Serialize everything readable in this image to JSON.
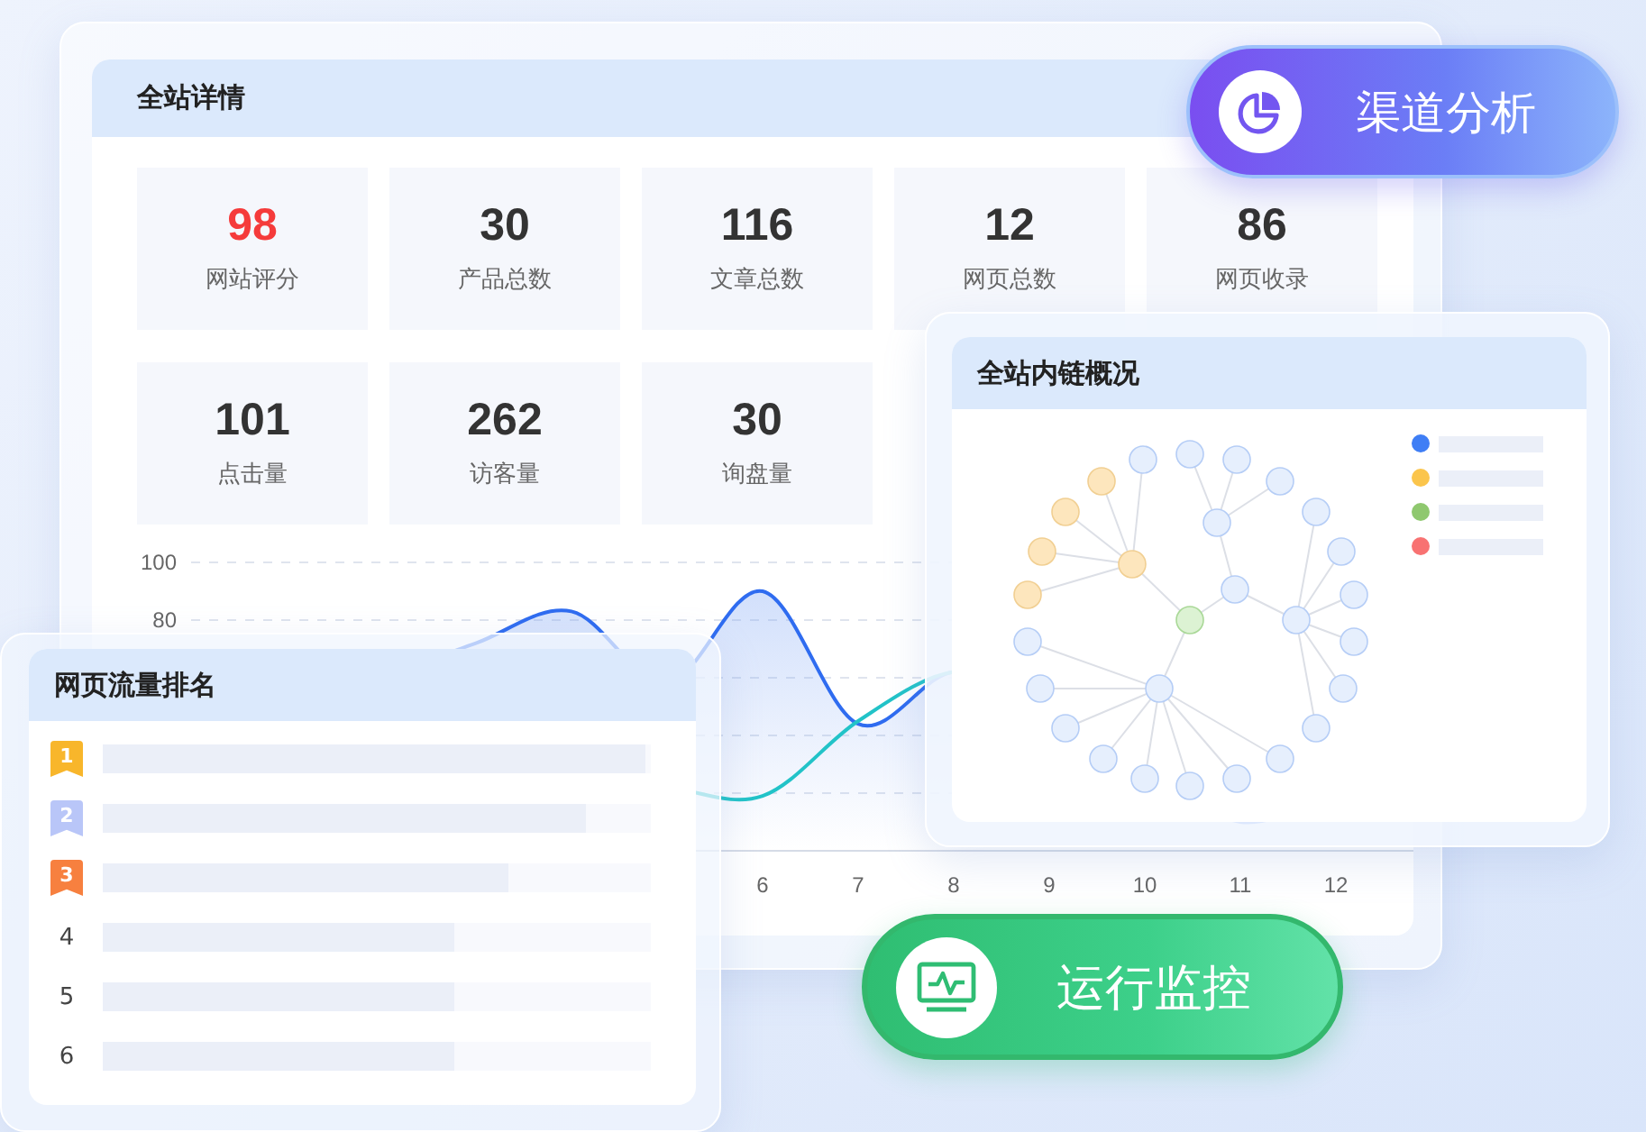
{
  "overview": {
    "title": "全站详情",
    "stats": [
      {
        "value": "98",
        "label": "网站评分",
        "color": "#f53b3b"
      },
      {
        "value": "30",
        "label": "产品总数",
        "color": "#333333"
      },
      {
        "value": "116",
        "label": "文章总数",
        "color": "#333333"
      },
      {
        "value": "12",
        "label": "网页总数",
        "color": "#333333"
      },
      {
        "value": "86",
        "label": "网页收录",
        "color": "#333333"
      },
      {
        "value": "101",
        "label": "点击量",
        "color": "#333333"
      },
      {
        "value": "262",
        "label": "访客量",
        "color": "#333333"
      },
      {
        "value": "30",
        "label": "询盘量",
        "color": "#333333"
      }
    ],
    "chart": {
      "y_labels": [
        "100",
        "80"
      ],
      "x_labels": [
        "6",
        "7",
        "8",
        "9",
        "10",
        "11",
        "12"
      ]
    }
  },
  "ranking": {
    "title": "网页流量排名",
    "rows": [
      {
        "rank": "1",
        "kind": "medal",
        "color": "#f8b62b",
        "level": 0.99
      },
      {
        "rank": "2",
        "kind": "medal",
        "color": "#b9c6f8",
        "level": 0.88
      },
      {
        "rank": "3",
        "kind": "medal",
        "color": "#f7803f",
        "level": 0.74
      },
      {
        "rank": "4",
        "kind": "plain",
        "level": 0.64
      },
      {
        "rank": "5",
        "kind": "plain",
        "level": 0.64
      },
      {
        "rank": "6",
        "kind": "plain",
        "level": 0.64
      }
    ]
  },
  "links": {
    "title": "全站内链概况",
    "legend": [
      {
        "color": "#3f7ef5"
      },
      {
        "color": "#fbc54c"
      },
      {
        "color": "#8fc86f"
      },
      {
        "color": "#f87272"
      }
    ]
  },
  "buttons": [
    {
      "label": "渠道分析",
      "kind": "channel"
    },
    {
      "label": "运行监控",
      "kind": "monitor"
    }
  ]
}
